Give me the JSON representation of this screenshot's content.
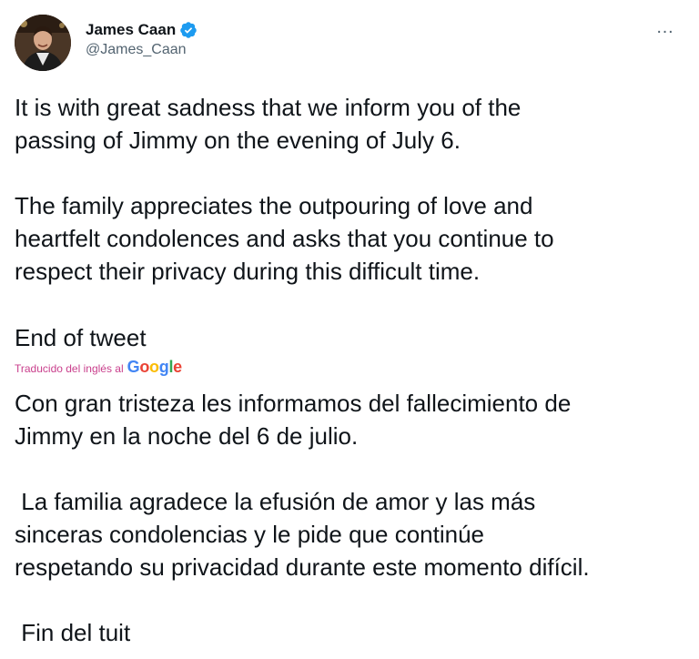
{
  "tweet": {
    "author": {
      "display_name": "James Caan",
      "handle": "@James_Caan",
      "verified": true,
      "avatar_icon": "avatar-photo"
    },
    "more_icon": "…",
    "paragraphs": [
      "It is with great sadness that we inform you of the\npassing of Jimmy on the evening of July 6.",
      "The family appreciates the outpouring of love and\nheartfelt condolences and asks that you continue to\nrespect their privacy during this difficult time.",
      "End of tweet"
    ],
    "translation": {
      "label": "Traducido del inglés al",
      "provider_letters": [
        "G",
        "o",
        "o",
        "g",
        "l",
        "e"
      ],
      "paragraphs": [
        "Con gran tristeza les informamos del fallecimiento de\nJimmy en la noche del 6 de julio.",
        " La familia agradece la efusión de amor y las más\nsinceras condolencias y le pide que continúe\nrespetando su privacidad durante este momento difícil.",
        " Fin del tuit"
      ]
    },
    "colors": {
      "text": "#0f1419",
      "secondary": "#536471",
      "verified": "#1d9bf0",
      "translated_label": "#c93f8c"
    }
  }
}
